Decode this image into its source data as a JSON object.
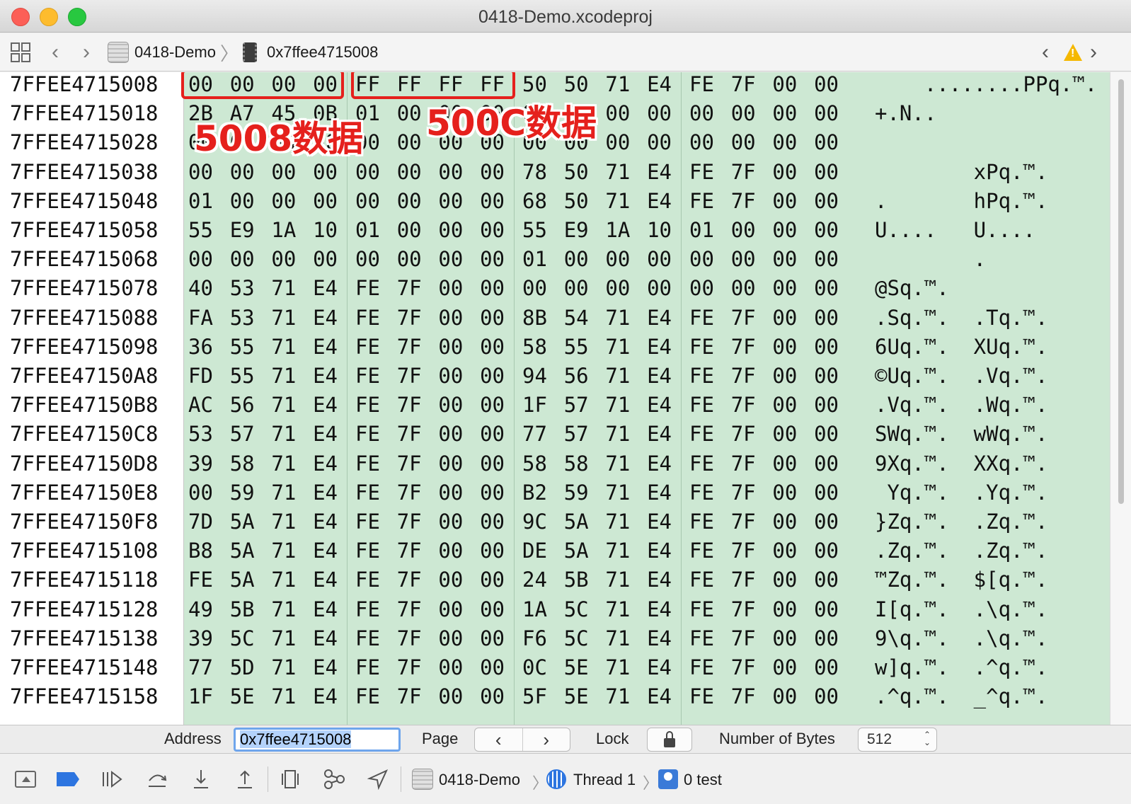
{
  "window": {
    "title": "0418-Demo.xcodeproj"
  },
  "jumpbar": {
    "project": "0418-Demo",
    "address": "0x7ffee4715008",
    "icons": [
      "grid-icon",
      "back-icon",
      "forward-icon",
      "project-icon",
      "memory-chip-icon",
      "warning-icon"
    ]
  },
  "memory": {
    "rows": [
      {
        "addr": "7FFEE4715008",
        "hex": "00 00 00 00  FF FF FF FF  50 50 71 E4  FE 7F 00 00",
        "ascii": "    ........PPq.™."
      },
      {
        "addr": "7FFEE4715018",
        "hex": "2B A7 45 0B  01 00 00 00  00 00 00 00  00 00 00 00",
        "ascii": "+.N.."
      },
      {
        "addr": "7FFEE4715028",
        "hex": "00 00 00 00  00 00 00 00  00 00 00 00  00 00 00 00",
        "ascii": ""
      },
      {
        "addr": "7FFEE4715038",
        "hex": "00 00 00 00  00 00 00 00  78 50 71 E4  FE 7F 00 00",
        "ascii": "        xPq.™."
      },
      {
        "addr": "7FFEE4715048",
        "hex": "01 00 00 00  00 00 00 00  68 50 71 E4  FE 7F 00 00",
        "ascii": ".       hPq.™."
      },
      {
        "addr": "7FFEE4715058",
        "hex": "55 E9 1A 10  01 00 00 00  55 E9 1A 10  01 00 00 00",
        "ascii": "U....   U...."
      },
      {
        "addr": "7FFEE4715068",
        "hex": "00 00 00 00  00 00 00 00  01 00 00 00  00 00 00 00",
        "ascii": "        ."
      },
      {
        "addr": "7FFEE4715078",
        "hex": "40 53 71 E4  FE 7F 00 00  00 00 00 00  00 00 00 00",
        "ascii": "@Sq.™."
      },
      {
        "addr": "7FFEE4715088",
        "hex": "FA 53 71 E4  FE 7F 00 00  8B 54 71 E4  FE 7F 00 00",
        "ascii": ".Sq.™.  .Tq.™."
      },
      {
        "addr": "7FFEE4715098",
        "hex": "36 55 71 E4  FE 7F 00 00  58 55 71 E4  FE 7F 00 00",
        "ascii": "6Uq.™.  XUq.™."
      },
      {
        "addr": "7FFEE47150A8",
        "hex": "FD 55 71 E4  FE 7F 00 00  94 56 71 E4  FE 7F 00 00",
        "ascii": "©Uq.™.  .Vq.™."
      },
      {
        "addr": "7FFEE47150B8",
        "hex": "AC 56 71 E4  FE 7F 00 00  1F 57 71 E4  FE 7F 00 00",
        "ascii": ".Vq.™.  .Wq.™."
      },
      {
        "addr": "7FFEE47150C8",
        "hex": "53 57 71 E4  FE 7F 00 00  77 57 71 E4  FE 7F 00 00",
        "ascii": "SWq.™.  wWq.™."
      },
      {
        "addr": "7FFEE47150D8",
        "hex": "39 58 71 E4  FE 7F 00 00  58 58 71 E4  FE 7F 00 00",
        "ascii": "9Xq.™.  XXq.™."
      },
      {
        "addr": "7FFEE47150E8",
        "hex": "00 59 71 E4  FE 7F 00 00  B2 59 71 E4  FE 7F 00 00",
        "ascii": " Yq.™.  .Yq.™."
      },
      {
        "addr": "7FFEE47150F8",
        "hex": "7D 5A 71 E4  FE 7F 00 00  9C 5A 71 E4  FE 7F 00 00",
        "ascii": "}Zq.™.  .Zq.™."
      },
      {
        "addr": "7FFEE4715108",
        "hex": "B8 5A 71 E4  FE 7F 00 00  DE 5A 71 E4  FE 7F 00 00",
        "ascii": ".Zq.™.  .Zq.™."
      },
      {
        "addr": "7FFEE4715118",
        "hex": "FE 5A 71 E4  FE 7F 00 00  24 5B 71 E4  FE 7F 00 00",
        "ascii": "™Zq.™.  $[q.™."
      },
      {
        "addr": "7FFEE4715128",
        "hex": "49 5B 71 E4  FE 7F 00 00  1A 5C 71 E4  FE 7F 00 00",
        "ascii": "I[q.™.  .\\q.™."
      },
      {
        "addr": "7FFEE4715138",
        "hex": "39 5C 71 E4  FE 7F 00 00  F6 5C 71 E4  FE 7F 00 00",
        "ascii": "9\\q.™.  .\\q.™."
      },
      {
        "addr": "7FFEE4715148",
        "hex": "77 5D 71 E4  FE 7F 00 00  0C 5E 71 E4  FE 7F 00 00",
        "ascii": "w]q.™.  .^q.™."
      },
      {
        "addr": "7FFEE4715158",
        "hex": "1F 5E 71 E4  FE 7F 00 00  5F 5E 71 E4  FE 7F 00 00",
        "ascii": ".^q.™.  _^q.™."
      }
    ]
  },
  "annotations": {
    "label_5008": "5008数据",
    "label_500c": "500C数据",
    "color": "#e5201c"
  },
  "footer": {
    "address_label": "Address",
    "address_value": "0x7ffee4715008",
    "page_label": "Page",
    "page_prev": "‹",
    "page_next": "›",
    "lock_label": "Lock",
    "bytes_label": "Number of Bytes",
    "bytes_value": "512"
  },
  "debugbar": {
    "project": "0418-Demo",
    "thread": "Thread 1",
    "frame": "0 test"
  },
  "colors": {
    "hex_bg": "#cde8d3",
    "accent": "#2d75e0",
    "warning": "#f5b800"
  }
}
